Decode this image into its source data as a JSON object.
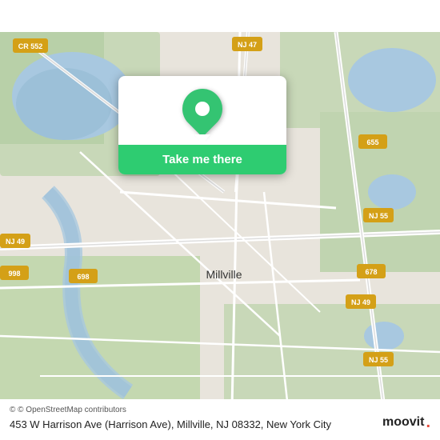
{
  "map": {
    "center_label": "Millville",
    "attribution": "© OpenStreetMap contributors",
    "bg_color": "#e8e0d8",
    "road_color": "#ffffff",
    "green_color": "#b5d5a0",
    "water_color": "#a8cce0"
  },
  "popup": {
    "button_label": "Take me there",
    "button_color": "#34c472",
    "icon_color": "#34c472"
  },
  "bottom_bar": {
    "attribution": "© OpenStreetMap contributors",
    "address": "453 W Harrison Ave (Harrison Ave), Millville, NJ 08332, New York City"
  },
  "moovit": {
    "text": "moovit"
  },
  "route_badges": [
    {
      "label": "CR 552",
      "color": "#d4a017"
    },
    {
      "label": "NJ 47",
      "color": "#d4a017"
    },
    {
      "label": "655",
      "color": "#d4a017"
    },
    {
      "label": "NJ 55",
      "color": "#d4a017"
    },
    {
      "label": "698",
      "color": "#d4a017"
    },
    {
      "label": "678",
      "color": "#d4a017"
    },
    {
      "label": "NJ 49",
      "color": "#d4a017"
    },
    {
      "label": "NJ 49",
      "color": "#d4a017"
    },
    {
      "label": "NJ 55",
      "color": "#d4a017"
    },
    {
      "label": "998",
      "color": "#d4a017"
    }
  ]
}
